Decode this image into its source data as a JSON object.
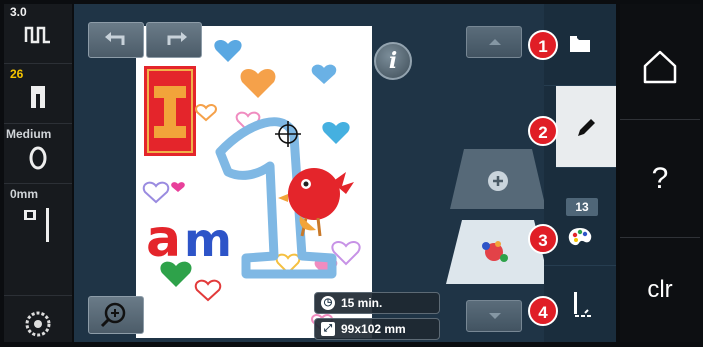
{
  "status": {
    "speed": "3.0",
    "count": "26",
    "tension": "Medium",
    "offset": "0mm"
  },
  "design": {
    "time": "15 min.",
    "size": "99x102 mm"
  },
  "tabs": {
    "color_count": "13"
  },
  "callouts": [
    "1",
    "2",
    "3",
    "4"
  ],
  "far_right": {
    "help_label": "?",
    "clear_label": "clr"
  },
  "colors": {
    "speed": "#f2f2f2",
    "count": "#f5c400",
    "tension": "#d0d4d8",
    "offset": "#d0d4d8",
    "callout": "#e01e26"
  },
  "icons": [
    "stitch-icon",
    "presser-foot-icon",
    "tension-icon",
    "needle-icon",
    "bobbin-icon",
    "undo-icon",
    "redo-icon",
    "info-icon",
    "zoom-icon",
    "clock-icon",
    "resize-icon",
    "arrow-up-icon",
    "arrow-down-icon",
    "folder-icon",
    "pencil-icon",
    "color-palette-icon",
    "needle-stitch-icon",
    "home-icon",
    "help-icon"
  ]
}
